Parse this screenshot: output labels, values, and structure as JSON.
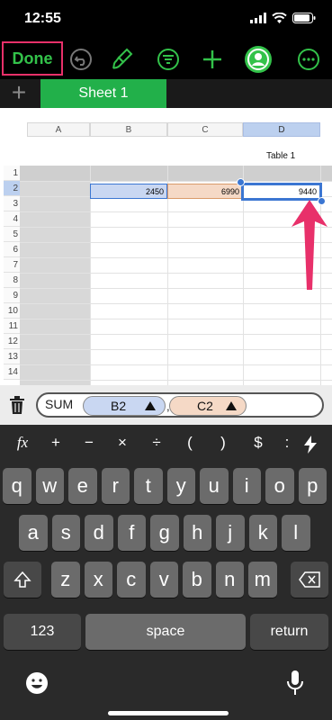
{
  "status_bar": {
    "time": "12:55"
  },
  "toolbar": {
    "done_label": "Done",
    "icons": [
      "undo-icon",
      "paintbrush-icon",
      "filter-icon",
      "add-icon",
      "collaborate-icon",
      "more-icon"
    ]
  },
  "tabs": {
    "add_symbol": "+",
    "active_sheet": "Sheet 1"
  },
  "sheet": {
    "columns": [
      "A",
      "B",
      "C",
      "D"
    ],
    "table_title": "Table 1",
    "rows": [
      "1",
      "2",
      "3",
      "4",
      "5",
      "6",
      "7",
      "8",
      "9",
      "10",
      "11",
      "12",
      "13",
      "14"
    ],
    "cells": {
      "B2": "2450",
      "C2": "6990",
      "D2": "9440"
    }
  },
  "formula": {
    "function": "SUM",
    "arg1": "B2",
    "separator": ",",
    "arg2": "C2"
  },
  "keyboard": {
    "symbols": [
      "fx",
      "+",
      "−",
      "×",
      "÷",
      "(",
      ")",
      "$",
      ":"
    ],
    "row1": [
      "q",
      "w",
      "e",
      "r",
      "t",
      "y",
      "u",
      "i",
      "o",
      "p"
    ],
    "row2": [
      "a",
      "s",
      "d",
      "f",
      "g",
      "h",
      "j",
      "k",
      "l"
    ],
    "row3": [
      "z",
      "x",
      "c",
      "v",
      "b",
      "n",
      "m"
    ],
    "numbers_label": "123",
    "space_label": "space",
    "return_label": "return"
  },
  "colors": {
    "accent_green": "#22b04a",
    "highlight_pink": "#e8306a",
    "b2_ref": "#c9d7f2",
    "c2_ref": "#f5d9c6",
    "selection_blue": "#3b76d2"
  }
}
